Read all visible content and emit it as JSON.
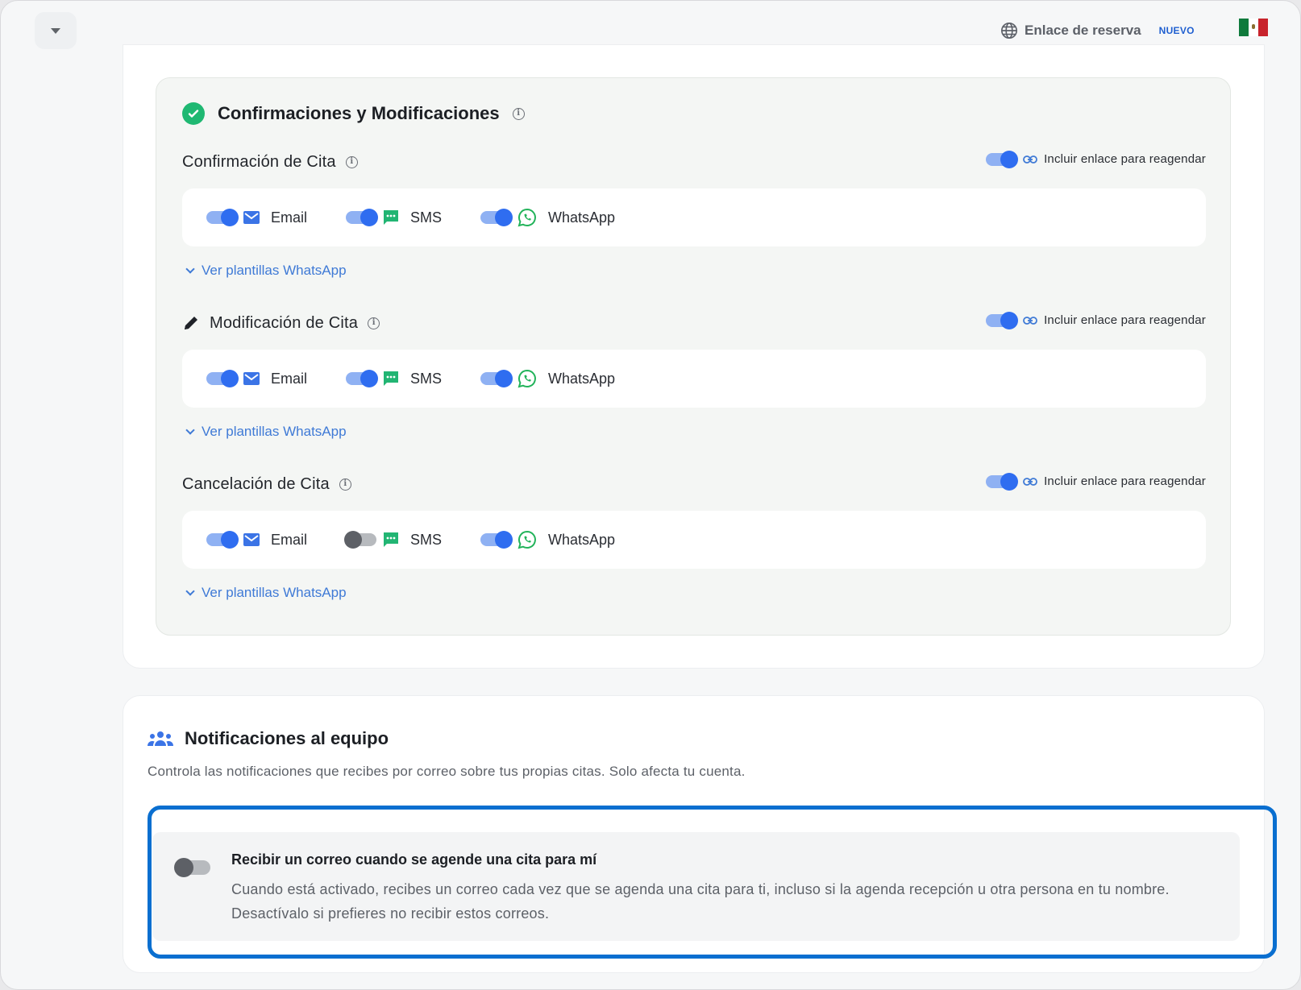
{
  "header": {
    "booking_link_label": "Enlace de reserva",
    "new_badge": "NUEVO",
    "flag_colors": [
      "#0f7a3c",
      "#ffffff",
      "#c8232c"
    ]
  },
  "confirmations": {
    "title": "Confirmaciones y Modificaciones",
    "sections": [
      {
        "title": "Confirmación de Cita",
        "reschedule_label": "Incluir enlace para reagendar",
        "reschedule_on": true,
        "channels": [
          {
            "label": "Email",
            "on": true
          },
          {
            "label": "SMS",
            "on": true
          },
          {
            "label": "WhatsApp",
            "on": true
          }
        ],
        "templates_link": "Ver plantillas WhatsApp"
      },
      {
        "title": "Modificación de Cita",
        "reschedule_label": "Incluir enlace para reagendar",
        "reschedule_on": true,
        "channels": [
          {
            "label": "Email",
            "on": true
          },
          {
            "label": "SMS",
            "on": true
          },
          {
            "label": "WhatsApp",
            "on": true
          }
        ],
        "templates_link": "Ver plantillas WhatsApp"
      },
      {
        "title": "Cancelación de Cita",
        "reschedule_label": "Incluir enlace para reagendar",
        "reschedule_on": true,
        "channels": [
          {
            "label": "Email",
            "on": true
          },
          {
            "label": "SMS",
            "on": false
          },
          {
            "label": "WhatsApp",
            "on": true
          }
        ],
        "templates_link": "Ver plantillas WhatsApp"
      }
    ]
  },
  "team": {
    "title": "Notificaciones al equipo",
    "description": "Controla las notificaciones que recibes por correo sobre tus propias citas. Solo afecta tu cuenta.",
    "option": {
      "title": "Recibir un correo cuando se agende una cita para mí",
      "description_line1": "Cuando está activado, recibes un correo cada vez que se agenda una cita para ti, incluso si la agenda recepción u otra persona en tu nombre.",
      "description_line2": "Desactívalo si prefieres no recibir estos correos.",
      "on": false
    }
  },
  "colors": {
    "accent": "#2f6df0",
    "success": "#1fb872",
    "link": "#3f7ad6",
    "highlight": "#0a6fd0"
  }
}
